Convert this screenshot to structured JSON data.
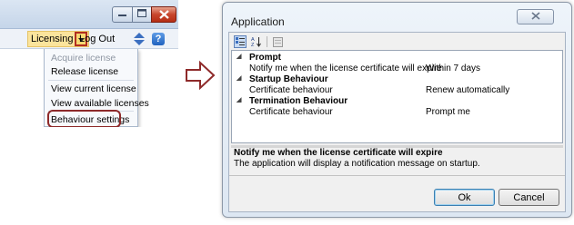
{
  "left_window": {
    "menubar": {
      "licensing_label": "Licensing",
      "logout_label": "Log Out"
    },
    "licensing_menu": {
      "items": [
        {
          "label": "Acquire license",
          "enabled": false
        },
        {
          "label": "Release license",
          "enabled": true
        },
        {
          "label": "View current license",
          "enabled": true
        },
        {
          "label": "View available licenses",
          "enabled": true
        },
        {
          "label": "Behaviour settings",
          "enabled": true,
          "highlighted": true
        }
      ]
    },
    "icons": [
      "minimize-icon",
      "maximize-icon",
      "close-icon",
      "dropdown-arrow-icon",
      "sort-arrows-icon",
      "help-icon"
    ]
  },
  "arrow": {
    "icon": "right-arrow-icon"
  },
  "dialog": {
    "title": "Application",
    "toolbar_icons": [
      "categorized-icon",
      "alphabetical-sort-icon",
      "property-pages-icon"
    ],
    "categories": [
      {
        "name": "Prompt",
        "properties": [
          {
            "name": "Notify me when the license certificate will expire",
            "value": "Within 7 days"
          }
        ]
      },
      {
        "name": "Startup Behaviour",
        "properties": [
          {
            "name": "Certificate behaviour",
            "value": "Renew automatically"
          }
        ]
      },
      {
        "name": "Termination Behaviour",
        "properties": [
          {
            "name": "Certificate behaviour",
            "value": "Prompt me"
          }
        ]
      }
    ],
    "description": {
      "title": "Notify me when the license certificate will expire",
      "text": "The application will display a notification message on startup."
    },
    "buttons": {
      "ok": "Ok",
      "cancel": "Cancel"
    }
  },
  "colors": {
    "highlight_outline": "#8e2a2a",
    "menu_highlight": "#fbe49c",
    "close_button": "#c8452c"
  }
}
